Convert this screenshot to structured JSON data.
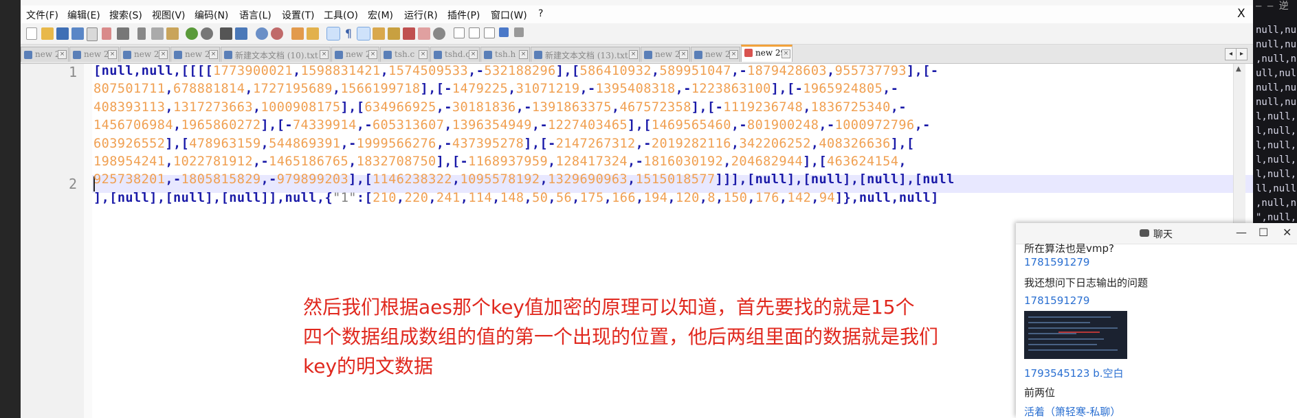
{
  "menu": [
    "文件(F)",
    "编辑(E)",
    "搜索(S)",
    "视图(V)",
    "编码(N)",
    "语言(L)",
    "设置(T)",
    "工具(O)",
    "宏(M)",
    "运行(R)",
    "插件(P)",
    "窗口(W)",
    "?"
  ],
  "window": {
    "close_label": "X"
  },
  "tabs": [
    {
      "label": "new 22",
      "active": false
    },
    {
      "label": "new 23",
      "active": false
    },
    {
      "label": "new 25",
      "active": false
    },
    {
      "label": "new 26",
      "active": false
    },
    {
      "label": "新建文本文档 (10).txt",
      "active": false
    },
    {
      "label": "new 24",
      "active": false
    },
    {
      "label": "tsh.c",
      "active": false
    },
    {
      "label": "tshd.c",
      "active": false
    },
    {
      "label": "tsh.h",
      "active": false
    },
    {
      "label": "新建文本文档 (13).txt",
      "active": false
    },
    {
      "label": "new 28",
      "active": false
    },
    {
      "label": "new 27",
      "active": false
    },
    {
      "label": "new 29",
      "active": true
    }
  ],
  "editor": {
    "line_numbers": [
      "1",
      "2"
    ],
    "line1_wrapped": [
      "[null,null,[[[[1773900021,1598831421,1574509533,-532188296],[586410932,589951047,-1879428603,955737793],[-",
      "807501711,678881814,1727195689,1566199718],[-1479225,31071219,-1395408318,-1223863100],[-1965924805,-",
      "408393113,1317273663,1000908175],[634966925,-30181836,-1391863375,467572358],[-1119236748,1836725340,-",
      "1456706984,1965860272],[-74339914,-605313607,1396354949,-1227403465],[1469565460,-801900248,-1000972796,-",
      "603926552],[478963159,544869391,-1999566276,-437395278],[-2147267312,-2019282116,342206252,408326636],[",
      "198954241,1022781912,-1465186765,1832708750],[-1168937959,128417324,-1816030192,204682944],[463624154,",
      "925738201,-1805815829,-979899203],[1146238322,1095578192,1329690963,1515018577]]],[null],[null],[null],[null",
      "],[null],[null],[null]],null,{\"1\":[210,220,241,114,148,50,56,175,166,194,120,8,150,176,142,94]},null,null]"
    ]
  },
  "subtitle": [
    "然后我们根据aes那个key值加密的原理可以知道，首先要找的就是15个",
    "四个数据组成数组的值的第一个出现的位置，他后两组里面的数据就是我们",
    "key的明文数据"
  ],
  "chat": {
    "title": "聊天",
    "clipped_top": "所在算法也是vmp?",
    "messages": [
      {
        "type": "user",
        "text": "1781591279"
      },
      {
        "type": "msg",
        "text": "我还想问下日志输出的问题"
      },
      {
        "type": "user",
        "text": "1781591279"
      },
      {
        "type": "image"
      },
      {
        "type": "user",
        "text": "1793545123 b.空白"
      },
      {
        "type": "msg",
        "text": "前两位"
      },
      {
        "type": "user",
        "text": "活着（箫轻寒-私聊）"
      }
    ]
  },
  "right_strip": [
    "null,nu",
    "null,nu",
    ",null,nu",
    "ull,nul",
    "null,nu",
    "null,nu",
    "l,null,",
    "l,null,",
    "l,null,",
    "l,null,",
    "l,null,",
    "ll,null",
    ",null,nu",
    "\",null,"
  ]
}
